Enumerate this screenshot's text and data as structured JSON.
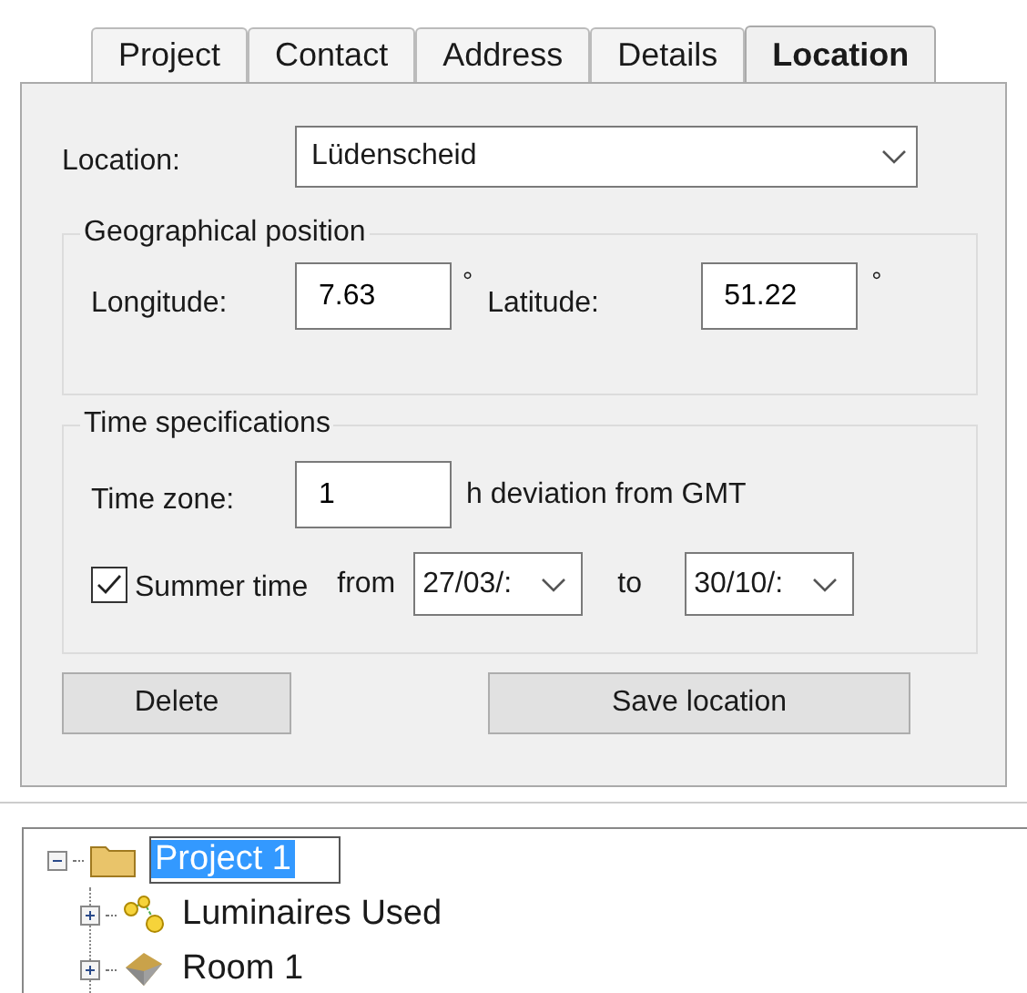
{
  "tabs": [
    {
      "label": "Project",
      "selected": false
    },
    {
      "label": "Contact",
      "selected": false
    },
    {
      "label": "Address",
      "selected": false
    },
    {
      "label": "Details",
      "selected": false
    },
    {
      "label": "Location",
      "selected": true
    }
  ],
  "location": {
    "label": "Location:",
    "value": "Lüdenscheid"
  },
  "geo": {
    "legend": "Geographical position",
    "longitude_label": "Longitude:",
    "longitude": "7.63",
    "longitude_unit": "°",
    "latitude_label": "Latitude:",
    "latitude": "51.22",
    "latitude_unit": "°"
  },
  "time": {
    "legend": "Time specifications",
    "zone_label": "Time zone:",
    "zone": "1",
    "zone_unit": "h deviation from GMT",
    "summer_label": "Summer time",
    "summer_checked": true,
    "from_label": "from",
    "from": "27/03/:",
    "to_label": "to",
    "to": "30/10/:"
  },
  "buttons": [
    "Delete",
    "Save location"
  ],
  "tree": [
    {
      "label": "Project 1",
      "kind": "folder",
      "expanded": true,
      "selected": true,
      "children": [
        {
          "label": "Luminaires Used",
          "kind": "luminaires",
          "expanded": false,
          "selected": false
        },
        {
          "label": "Room 1",
          "kind": "room",
          "expanded": false,
          "selected": false
        }
      ]
    }
  ]
}
